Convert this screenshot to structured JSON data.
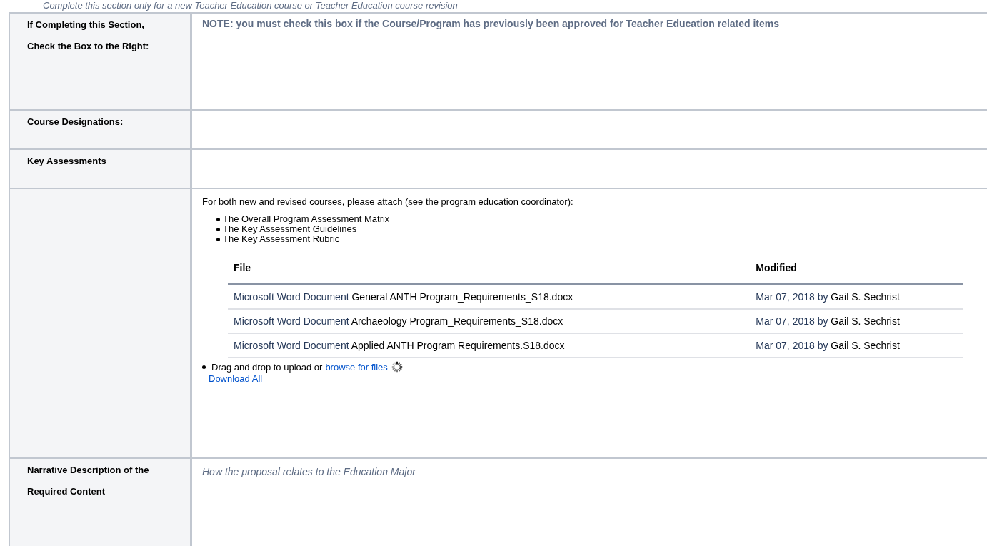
{
  "intro": "Complete this section only for a new Teacher Education course or Teacher Education course revision",
  "rows": [
    {
      "kind": "note",
      "label": [
        "If Completing this Section,",
        "Check the Box to the Right:"
      ],
      "note": "NOTE: you must check this box if the Course/Program has previously been approved for Teacher Education related items"
    },
    {
      "kind": "empty",
      "label": [
        "Course Designations:"
      ]
    },
    {
      "kind": "empty",
      "label": [
        "Key Assessments"
      ]
    },
    {
      "kind": "attachments",
      "label": [],
      "intro": "For both new and revised courses, please attach (see the program education coordinator):",
      "bullets": [
        "The Overall Program Assessment Matrix",
        "The Key Assessment Guidelines",
        "The Key Assessment Rubric"
      ],
      "columns": [
        "File",
        "Modified"
      ],
      "files": [
        {
          "type": "Microsoft Word Document",
          "name": "General ANTH Program_Requirements_S18.docx",
          "date": "Mar 07, 2018 by",
          "author": "Gail S. Sechrist"
        },
        {
          "type": "Microsoft Word Document",
          "name": "Archaeology Program_Requirements_S18.docx",
          "date": "Mar 07, 2018 by",
          "author": "Gail S. Sechrist"
        },
        {
          "type": "Microsoft Word Document",
          "name": "Applied ANTH Program Requirements.S18.docx",
          "date": "Mar 07, 2018 by",
          "author": "Gail S. Sechrist"
        }
      ],
      "upload_text": "Drag and drop to upload or",
      "browse_link": "browse for files",
      "download_link": "Download All"
    },
    {
      "kind": "placeholder",
      "label": [
        "Narrative Description of the",
        "Required Content"
      ],
      "placeholder": "How the proposal relates to the Education Major"
    }
  ]
}
